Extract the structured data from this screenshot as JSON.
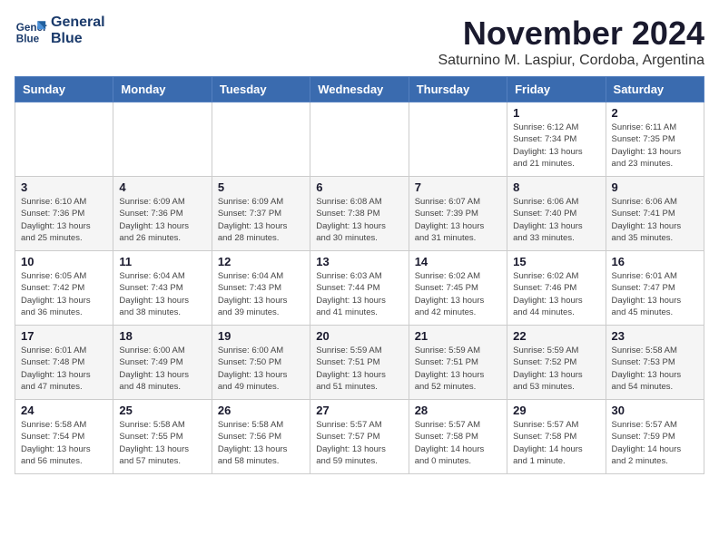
{
  "logo": {
    "line1": "General",
    "line2": "Blue"
  },
  "title": "November 2024",
  "subtitle": "Saturnino M. Laspiur, Cordoba, Argentina",
  "weekdays": [
    "Sunday",
    "Monday",
    "Tuesday",
    "Wednesday",
    "Thursday",
    "Friday",
    "Saturday"
  ],
  "weeks": [
    [
      {
        "day": "",
        "info": ""
      },
      {
        "day": "",
        "info": ""
      },
      {
        "day": "",
        "info": ""
      },
      {
        "day": "",
        "info": ""
      },
      {
        "day": "",
        "info": ""
      },
      {
        "day": "1",
        "info": "Sunrise: 6:12 AM\nSunset: 7:34 PM\nDaylight: 13 hours\nand 21 minutes."
      },
      {
        "day": "2",
        "info": "Sunrise: 6:11 AM\nSunset: 7:35 PM\nDaylight: 13 hours\nand 23 minutes."
      }
    ],
    [
      {
        "day": "3",
        "info": "Sunrise: 6:10 AM\nSunset: 7:36 PM\nDaylight: 13 hours\nand 25 minutes."
      },
      {
        "day": "4",
        "info": "Sunrise: 6:09 AM\nSunset: 7:36 PM\nDaylight: 13 hours\nand 26 minutes."
      },
      {
        "day": "5",
        "info": "Sunrise: 6:09 AM\nSunset: 7:37 PM\nDaylight: 13 hours\nand 28 minutes."
      },
      {
        "day": "6",
        "info": "Sunrise: 6:08 AM\nSunset: 7:38 PM\nDaylight: 13 hours\nand 30 minutes."
      },
      {
        "day": "7",
        "info": "Sunrise: 6:07 AM\nSunset: 7:39 PM\nDaylight: 13 hours\nand 31 minutes."
      },
      {
        "day": "8",
        "info": "Sunrise: 6:06 AM\nSunset: 7:40 PM\nDaylight: 13 hours\nand 33 minutes."
      },
      {
        "day": "9",
        "info": "Sunrise: 6:06 AM\nSunset: 7:41 PM\nDaylight: 13 hours\nand 35 minutes."
      }
    ],
    [
      {
        "day": "10",
        "info": "Sunrise: 6:05 AM\nSunset: 7:42 PM\nDaylight: 13 hours\nand 36 minutes."
      },
      {
        "day": "11",
        "info": "Sunrise: 6:04 AM\nSunset: 7:43 PM\nDaylight: 13 hours\nand 38 minutes."
      },
      {
        "day": "12",
        "info": "Sunrise: 6:04 AM\nSunset: 7:43 PM\nDaylight: 13 hours\nand 39 minutes."
      },
      {
        "day": "13",
        "info": "Sunrise: 6:03 AM\nSunset: 7:44 PM\nDaylight: 13 hours\nand 41 minutes."
      },
      {
        "day": "14",
        "info": "Sunrise: 6:02 AM\nSunset: 7:45 PM\nDaylight: 13 hours\nand 42 minutes."
      },
      {
        "day": "15",
        "info": "Sunrise: 6:02 AM\nSunset: 7:46 PM\nDaylight: 13 hours\nand 44 minutes."
      },
      {
        "day": "16",
        "info": "Sunrise: 6:01 AM\nSunset: 7:47 PM\nDaylight: 13 hours\nand 45 minutes."
      }
    ],
    [
      {
        "day": "17",
        "info": "Sunrise: 6:01 AM\nSunset: 7:48 PM\nDaylight: 13 hours\nand 47 minutes."
      },
      {
        "day": "18",
        "info": "Sunrise: 6:00 AM\nSunset: 7:49 PM\nDaylight: 13 hours\nand 48 minutes."
      },
      {
        "day": "19",
        "info": "Sunrise: 6:00 AM\nSunset: 7:50 PM\nDaylight: 13 hours\nand 49 minutes."
      },
      {
        "day": "20",
        "info": "Sunrise: 5:59 AM\nSunset: 7:51 PM\nDaylight: 13 hours\nand 51 minutes."
      },
      {
        "day": "21",
        "info": "Sunrise: 5:59 AM\nSunset: 7:51 PM\nDaylight: 13 hours\nand 52 minutes."
      },
      {
        "day": "22",
        "info": "Sunrise: 5:59 AM\nSunset: 7:52 PM\nDaylight: 13 hours\nand 53 minutes."
      },
      {
        "day": "23",
        "info": "Sunrise: 5:58 AM\nSunset: 7:53 PM\nDaylight: 13 hours\nand 54 minutes."
      }
    ],
    [
      {
        "day": "24",
        "info": "Sunrise: 5:58 AM\nSunset: 7:54 PM\nDaylight: 13 hours\nand 56 minutes."
      },
      {
        "day": "25",
        "info": "Sunrise: 5:58 AM\nSunset: 7:55 PM\nDaylight: 13 hours\nand 57 minutes."
      },
      {
        "day": "26",
        "info": "Sunrise: 5:58 AM\nSunset: 7:56 PM\nDaylight: 13 hours\nand 58 minutes."
      },
      {
        "day": "27",
        "info": "Sunrise: 5:57 AM\nSunset: 7:57 PM\nDaylight: 13 hours\nand 59 minutes."
      },
      {
        "day": "28",
        "info": "Sunrise: 5:57 AM\nSunset: 7:58 PM\nDaylight: 14 hours\nand 0 minutes."
      },
      {
        "day": "29",
        "info": "Sunrise: 5:57 AM\nSunset: 7:58 PM\nDaylight: 14 hours\nand 1 minute."
      },
      {
        "day": "30",
        "info": "Sunrise: 5:57 AM\nSunset: 7:59 PM\nDaylight: 14 hours\nand 2 minutes."
      }
    ]
  ]
}
